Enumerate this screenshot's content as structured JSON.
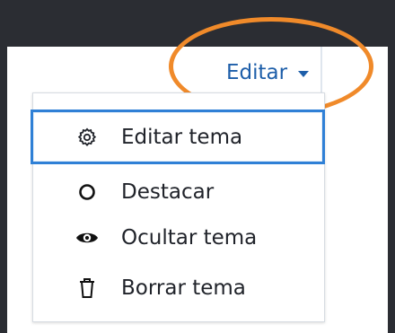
{
  "header": {
    "edit_label": "Editar"
  },
  "menu": {
    "items": [
      {
        "label": "Editar tema",
        "icon": "gear-icon",
        "selected": true
      },
      {
        "label": "Destacar",
        "icon": "circle-icon",
        "selected": false
      },
      {
        "label": "Ocultar tema",
        "icon": "eye-icon",
        "selected": false
      },
      {
        "label": "Borrar tema",
        "icon": "trash-icon",
        "selected": false
      }
    ]
  },
  "colors": {
    "accent": "#1d5ea9",
    "focus_border": "#2f80d6",
    "highlight_ring": "#f08a2a",
    "background": "#2b2d33"
  }
}
